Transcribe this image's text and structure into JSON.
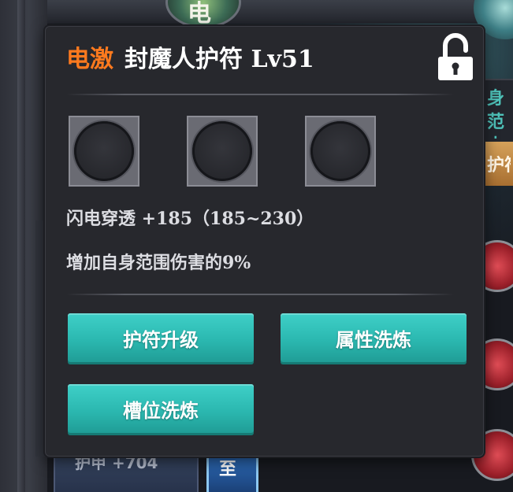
{
  "background": {
    "top_emblem_glyph": "电",
    "right_panel_text": "身范\n电穿",
    "right_gold_text": "护符",
    "bottom_slot_text": "护甲 +704",
    "bottom_gem_glyph": "至"
  },
  "tooltip": {
    "title_prefix": "电激",
    "title_name": "封魔人护符 Lv51",
    "lock_state": "unlocked",
    "sockets": [
      {
        "state": "empty"
      },
      {
        "state": "empty"
      },
      {
        "state": "empty"
      }
    ],
    "stat_main": "闪电穿透 +185（185~230）",
    "stat_effect": "增加自身范围伤害的9%",
    "buttons": {
      "upgrade": "护符升级",
      "reforge_attr": "属性洗炼",
      "reforge_slot": "槽位洗炼"
    }
  },
  "colors": {
    "prefix_orange": "#ff7a1e",
    "button_teal": "#2bb8b0",
    "panel_bg": "#27282d",
    "text_light": "#dcdde2"
  }
}
